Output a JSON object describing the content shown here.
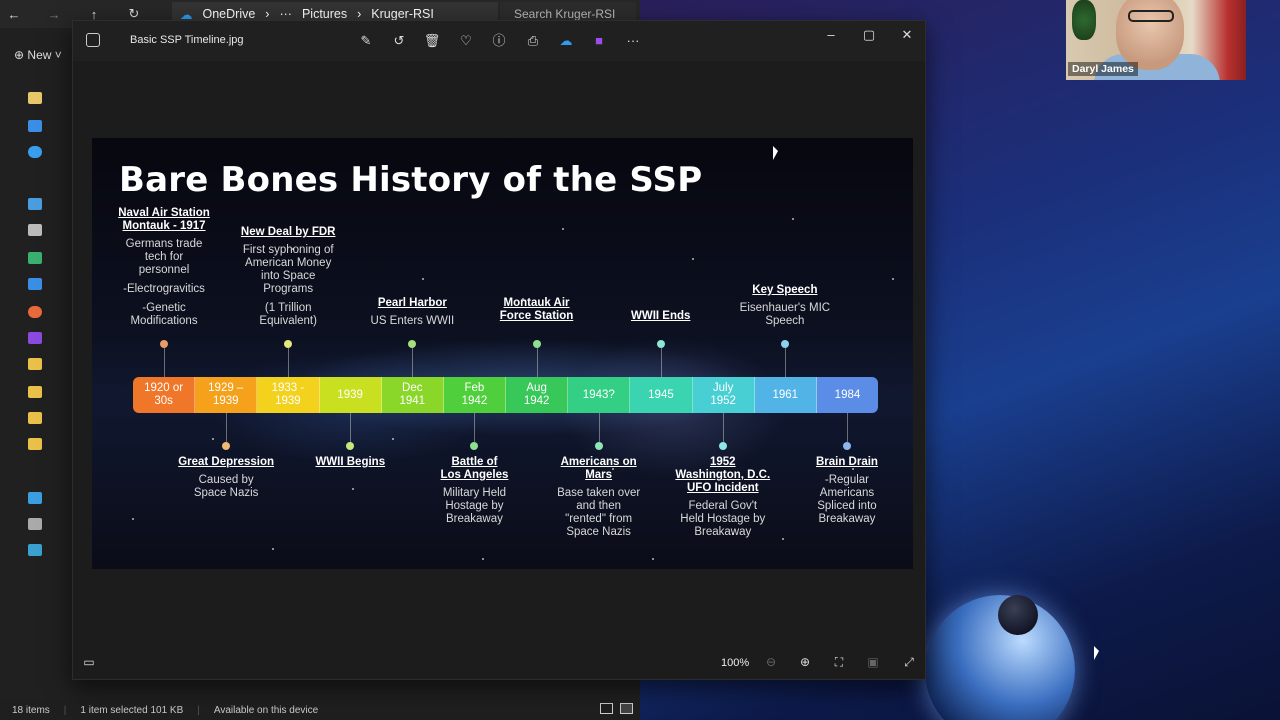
{
  "explorer": {
    "breadcrumb": [
      "OneDrive",
      "Pictures",
      "Kruger-RSI"
    ],
    "breadcrumb_more": "···",
    "search_placeholder": "Search Kruger-RSI",
    "new_label": "New",
    "status": {
      "items_count": "18 items",
      "selected": "1 item selected  101 KB",
      "availability": "Available on this device"
    }
  },
  "viewer": {
    "file_name": "Basic SSP Timeline.jpg",
    "zoom_level": "100%",
    "toolbar_icons": [
      "edit-icon",
      "rotate-icon",
      "delete-icon",
      "favorite-icon",
      "info-icon",
      "print-icon",
      "onedrive-icon",
      "clipchamp-icon",
      "more-icon"
    ]
  },
  "slide": {
    "title": "Bare Bones History of the SSP",
    "segments": [
      {
        "label": "1920 or\n30s",
        "color": "#f0762a"
      },
      {
        "label": "1929 –\n1939",
        "color": "#f5a11c"
      },
      {
        "label": "1933 -\n1939",
        "color": "#f2d21d"
      },
      {
        "label": "1939",
        "color": "#c9e021"
      },
      {
        "label": "Dec\n1941",
        "color": "#8ad629"
      },
      {
        "label": "Feb\n1942",
        "color": "#4fcf3c"
      },
      {
        "label": "Aug\n1942",
        "color": "#38c85a"
      },
      {
        "label": "1943?",
        "color": "#33cf84"
      },
      {
        "label": "1945",
        "color": "#3bd4b0"
      },
      {
        "label": "July\n1952",
        "color": "#47cfd3"
      },
      {
        "label": "1961",
        "color": "#52b4e6"
      },
      {
        "label": "1984",
        "color": "#5b8de6"
      }
    ],
    "above": [
      {
        "heading": "Naval Air Station\nMontauk - 1917",
        "desc": [
          "Germans trade\ntech for\npersonnel",
          "-Electrogravitics",
          "-Genetic\nModifications"
        ],
        "dot": "#e89a6a"
      },
      {
        "heading": "New Deal by FDR",
        "desc": [
          "First syphoning of\nAmerican Money\ninto Space\nPrograms",
          "(1 Trillion\nEquivalent)"
        ],
        "dot": "#e6e67a"
      },
      {
        "heading": "Pearl Harbor",
        "desc": [
          "US Enters WWII"
        ],
        "dot": "#a6e07a"
      },
      {
        "heading": "Montauk Air\nForce Station",
        "desc": [],
        "dot": "#8ee08e"
      },
      {
        "heading": "WWII Ends",
        "desc": [],
        "dot": "#8ee6d6"
      },
      {
        "heading": "Key Speech",
        "desc": [
          "Eisenhauer's MIC\nSpeech"
        ],
        "dot": "#8ed0ee"
      }
    ],
    "below": [
      {
        "heading": "Great Depression",
        "desc": [
          "Caused by\nSpace Nazis"
        ],
        "dot": "#f0b870"
      },
      {
        "heading": "WWII Begins",
        "desc": [],
        "dot": "#c6e87a"
      },
      {
        "heading": "Battle of\nLos Angeles",
        "desc": [
          "Military Held\nHostage by\nBreakaway"
        ],
        "dot": "#8ee08e"
      },
      {
        "heading": "Americans on\nMars",
        "desc": [
          "Base taken over\nand then\n\"rented\" from\nSpace Nazis"
        ],
        "dot": "#8ee6b6"
      },
      {
        "heading": "1952\nWashington, D.C.\nUFO Incident",
        "desc": [
          "Federal Gov't\nHeld Hostage by\nBreakaway"
        ],
        "dot": "#8ee6e6"
      },
      {
        "heading": "Brain Drain",
        "desc": [
          "-Regular\nAmericans\nSpliced into\nBreakaway"
        ],
        "dot": "#8eb6ee"
      }
    ]
  },
  "webcam": {
    "participant_name": "Daryl James"
  }
}
